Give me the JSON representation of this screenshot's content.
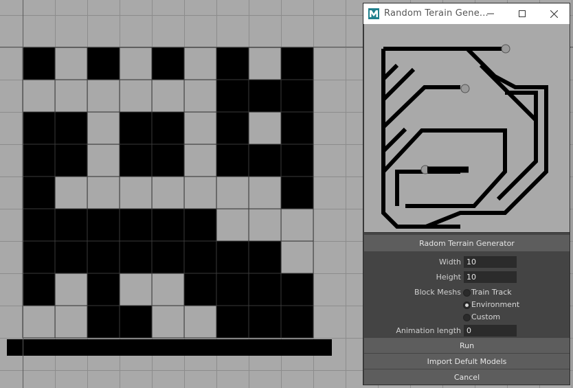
{
  "window": {
    "title": "Random Terain Gene...",
    "app_icon": "maya-icon",
    "minimize_icon": "minimize-icon",
    "maximize_icon": "maximize-icon",
    "close_icon": "close-icon"
  },
  "header": {
    "title": "Radom Terrain Generator"
  },
  "form": {
    "width_label": "Width",
    "width_value": "10",
    "height_label": "Height",
    "height_value": "10",
    "block_meshes_label": "Block Meshs",
    "options": [
      {
        "label": "Train Track",
        "selected": false
      },
      {
        "label": "Environment",
        "selected": true
      },
      {
        "label": "Custom",
        "selected": false
      }
    ],
    "animation_label": "Animation length",
    "animation_value": "0"
  },
  "buttons": {
    "run": "Run",
    "import": "Import Defult Models",
    "cancel": "Cancel"
  },
  "colors": {
    "viewport_bg": "#a9a9a9",
    "block": "#000000",
    "panel_bg": "#444444",
    "button_bg": "#5d5d5d"
  },
  "terrain_grid": [
    [
      1,
      0,
      1,
      0,
      1,
      0,
      1,
      0,
      1
    ],
    [
      0,
      0,
      0,
      0,
      0,
      0,
      1,
      1,
      1
    ],
    [
      1,
      1,
      0,
      1,
      1,
      0,
      1,
      0,
      1
    ],
    [
      1,
      1,
      0,
      1,
      1,
      0,
      1,
      1,
      1
    ],
    [
      1,
      0,
      0,
      0,
      0,
      0,
      0,
      0,
      1
    ],
    [
      1,
      1,
      1,
      1,
      1,
      1,
      0,
      0,
      0
    ],
    [
      1,
      1,
      1,
      1,
      1,
      1,
      1,
      1,
      0
    ],
    [
      1,
      0,
      1,
      0,
      0,
      1,
      1,
      1,
      1
    ],
    [
      0,
      0,
      1,
      1,
      0,
      0,
      1,
      1,
      1
    ]
  ]
}
